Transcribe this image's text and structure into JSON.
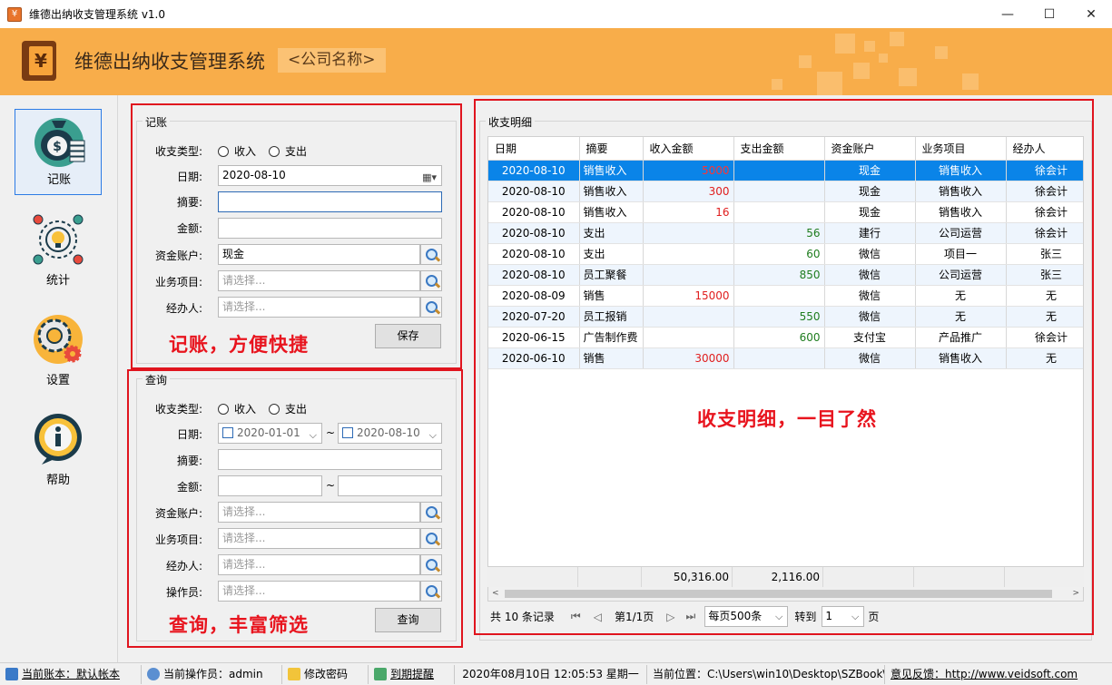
{
  "window": {
    "title": "维德出纳收支管理系统   v1.0",
    "minimize": "—",
    "maximize": "☐",
    "close": "✕"
  },
  "header": {
    "app_name": "维德出纳收支管理系统",
    "company": "<公司名称>"
  },
  "nav": [
    {
      "label": "记账",
      "icon": "money-bag-icon"
    },
    {
      "label": "统计",
      "icon": "lightbulb-stats-icon"
    },
    {
      "label": "设置",
      "icon": "gear-icon"
    },
    {
      "label": "帮助",
      "icon": "info-icon"
    }
  ],
  "entry": {
    "legend": "记账",
    "type_label": "收支类型:",
    "radio_income": "收入",
    "radio_expense": "支出",
    "date_label": "日期:",
    "date_value": "2020-08-10",
    "summary_label": "摘要:",
    "summary_value": "",
    "amount_label": "金额:",
    "amount_value": "",
    "account_label": "资金账户:",
    "account_value": "现金",
    "project_label": "业务项目:",
    "project_placeholder": "请选择...",
    "handler_label": "经办人:",
    "handler_placeholder": "请选择...",
    "save_button": "保存",
    "promo": "记账，方便快捷"
  },
  "query": {
    "legend": "查询",
    "type_label": "收支类型:",
    "radio_income": "收入",
    "radio_expense": "支出",
    "date_label": "日期:",
    "date_from": "2020-01-01",
    "date_to": "2020-08-10",
    "range_sep": "~",
    "summary_label": "摘要:",
    "amount_label": "金额:",
    "account_label": "资金账户:",
    "project_label": "业务项目:",
    "handler_label": "经办人:",
    "operator_label": "操作员:",
    "placeholder": "请选择...",
    "query_button": "查询",
    "promo": "查询，丰富筛选"
  },
  "detail": {
    "legend": "收支明细",
    "promo": "收支明细，一目了然",
    "columns": [
      "日期",
      "摘要",
      "收入金额",
      "支出金额",
      "资金账户",
      "业务项目",
      "经办人"
    ],
    "rows": [
      [
        "2020-08-10",
        "销售收入",
        "5000",
        "",
        "现金",
        "销售收入",
        "徐会计"
      ],
      [
        "2020-08-10",
        "销售收入",
        "300",
        "",
        "现金",
        "销售收入",
        "徐会计"
      ],
      [
        "2020-08-10",
        "销售收入",
        "16",
        "",
        "现金",
        "销售收入",
        "徐会计"
      ],
      [
        "2020-08-10",
        "支出",
        "",
        "56",
        "建行",
        "公司运营",
        "徐会计"
      ],
      [
        "2020-08-10",
        "支出",
        "",
        "60",
        "微信",
        "项目一",
        "张三"
      ],
      [
        "2020-08-10",
        "员工聚餐",
        "",
        "850",
        "微信",
        "公司运营",
        "张三"
      ],
      [
        "2020-08-09",
        "销售",
        "15000",
        "",
        "微信",
        "无",
        "无"
      ],
      [
        "2020-07-20",
        "员工报销",
        "",
        "550",
        "微信",
        "无",
        "无"
      ],
      [
        "2020-06-15",
        "广告制作费",
        "",
        "600",
        "支付宝",
        "产品推广",
        "徐会计"
      ],
      [
        "2020-06-10",
        "销售",
        "30000",
        "",
        "微信",
        "销售收入",
        "无"
      ]
    ],
    "total_income": "50,316.00",
    "total_expense": "2,116.00",
    "pager": {
      "records": "共 10 条记录",
      "page_info": "第1/1页",
      "page_size": "每页500条",
      "goto_label": "转到",
      "goto_value": "1",
      "page_suffix": "页"
    }
  },
  "statusbar": {
    "ledger": "当前账本：默认帐本",
    "operator": "当前操作员：admin",
    "change_password": "修改密码",
    "reminder": "到期提醒",
    "datetime": "2020年08月10日 12:05:53 星期一",
    "location": "当前位置：C:\\Users\\win10\\Desktop\\SZBook\\",
    "feedback": "意见反馈：http://www.veidsoft.com"
  }
}
